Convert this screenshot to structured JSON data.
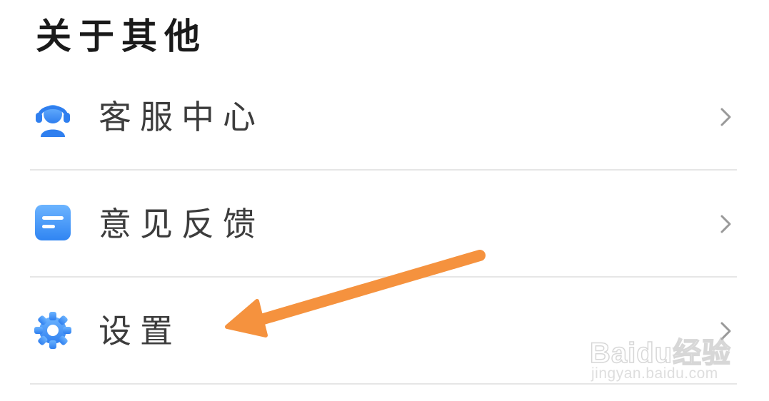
{
  "section": {
    "title": "关于其他"
  },
  "menu": {
    "items": [
      {
        "label": "客服中心",
        "icon": "headset-agent-icon"
      },
      {
        "label": "意见反馈",
        "icon": "feedback-note-icon"
      },
      {
        "label": "设置",
        "icon": "gear-icon"
      }
    ]
  },
  "annotation": {
    "arrow_color": "#f5923e"
  },
  "watermark": {
    "logo": "Baidu经验",
    "url": "jingyan.baidu.com"
  },
  "colors": {
    "icon_blue": "#3d8ff5",
    "icon_blue_light": "#6cb4ff",
    "text": "#3c3c3c",
    "title": "#1a1a1a",
    "divider": "#e6e6e6",
    "chevron": "#9a9a9a"
  }
}
